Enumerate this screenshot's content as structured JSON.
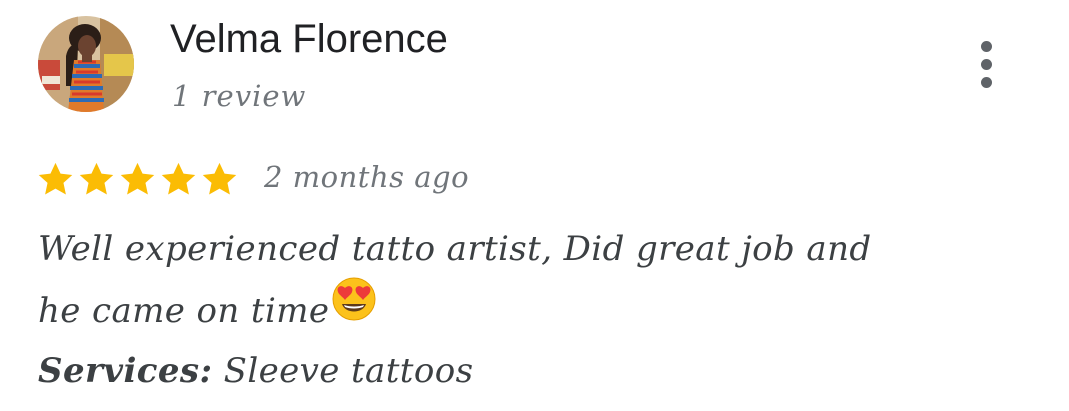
{
  "reviewer": {
    "name": "Velma Florence",
    "review_count": "1 review",
    "avatar_icon": "user-avatar-photo"
  },
  "menu": {
    "icon": "more-vert-icon"
  },
  "review": {
    "rating": 5,
    "rating_max": 5,
    "star_color": "#fbbc04",
    "date": "2 months ago",
    "text_line1": "Well experienced tatto artist, Did great job and",
    "text_line2": "he came on time",
    "emoji": "heart-eyes-emoji",
    "services_label": "Services:",
    "services_value": "Sleeve tattoos"
  }
}
